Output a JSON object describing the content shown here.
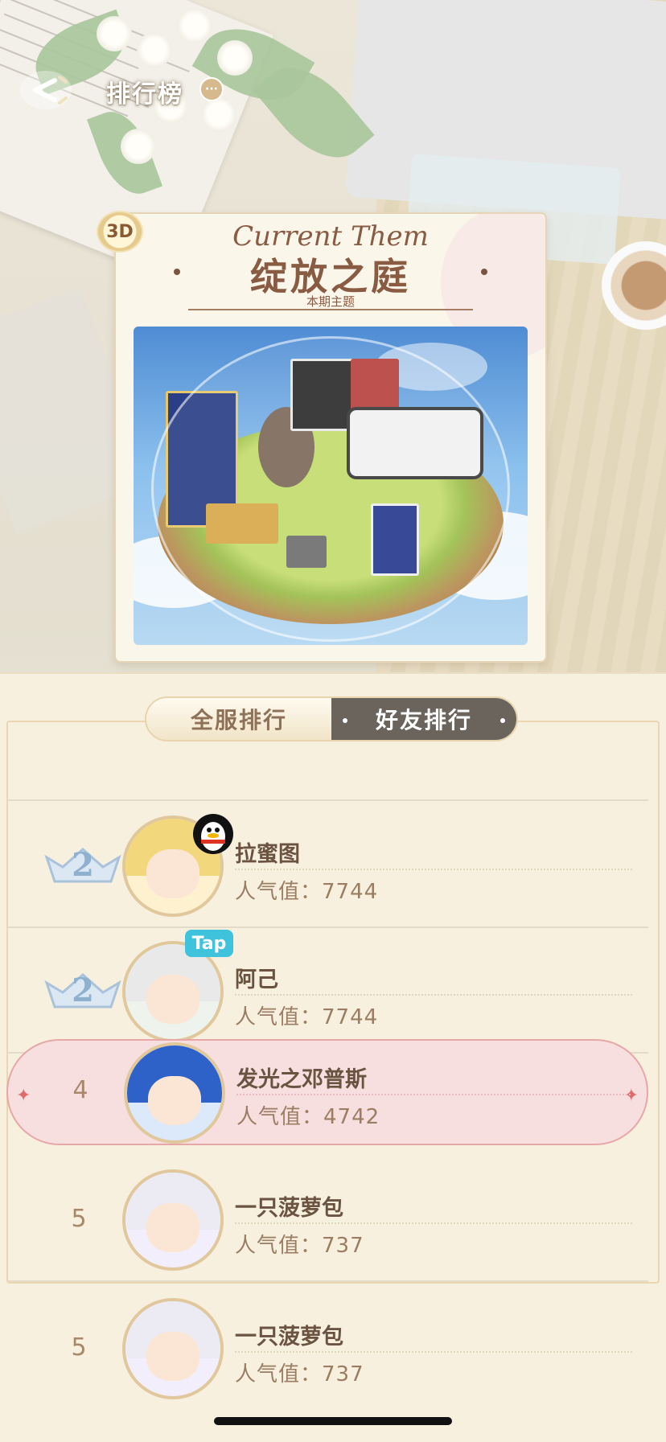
{
  "header": {
    "title": "排行榜",
    "info_glyph": "···"
  },
  "theme": {
    "badge_3d": "3D",
    "script_title": "Current Them",
    "name": "绽放之庭",
    "subtitle": "本期主题"
  },
  "tabs": {
    "server_label": "全服排行",
    "friends_label": "好友排行",
    "active": "friends"
  },
  "rankings": [
    {
      "rank": "2",
      "name": "拉蜜图",
      "score_label": "人气值：",
      "score": "7744",
      "crown": true,
      "badge": "qq-penguin-icon",
      "highlight": false
    },
    {
      "rank": "2",
      "name": "阿己",
      "score_label": "人气值：",
      "score": "7744",
      "crown": true,
      "badge": "taptap-icon",
      "badge_text": "Tap",
      "highlight": false
    },
    {
      "rank": "4",
      "name": "发光之邓普斯",
      "score_label": "人气值：",
      "score": "4742",
      "crown": false,
      "highlight": true
    },
    {
      "rank": "5",
      "name": "一只菠萝包",
      "score_label": "人气值：",
      "score": "737",
      "crown": false,
      "highlight": false
    },
    {
      "rank": "5",
      "name": "一只菠萝包",
      "score_label": "人气值：",
      "score": "737",
      "crown": false,
      "highlight": false
    }
  ],
  "colors": {
    "highlight_row": "#f7dfdf",
    "active_tab": "#6a645d",
    "crown_blue": "#8fb0cf",
    "title_brown": "#8a5b43"
  }
}
